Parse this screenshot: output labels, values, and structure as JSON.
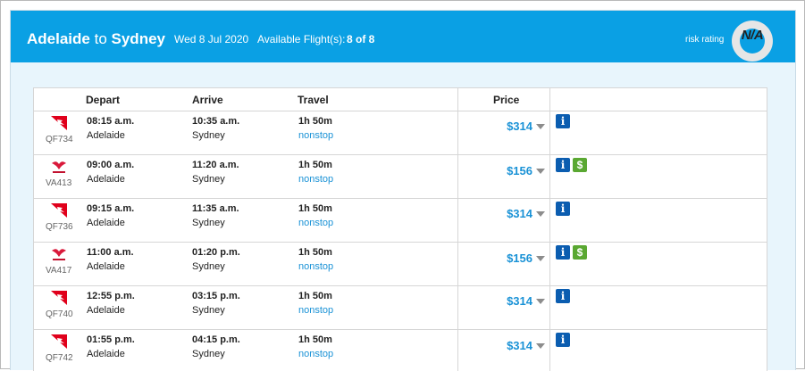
{
  "header": {
    "origin": "Adelaide",
    "to_word": "to",
    "destination": "Sydney",
    "date": "Wed 8 Jul 2020",
    "available_label": "Available Flight(s):",
    "available_count": "8 of 8",
    "risk_label": "risk rating",
    "risk_value": "N/A"
  },
  "columns": {
    "depart": "Depart",
    "arrive": "Arrive",
    "travel": "Travel",
    "price": "Price"
  },
  "colors": {
    "header_bg": "#0aa0e4",
    "price_text": "#1a92d6",
    "info_badge": "#0b5db0",
    "deal_badge": "#5aa832"
  },
  "flights": [
    {
      "airline_icon": "qantas-logo",
      "code": "QF734",
      "depart_time": "08:15 a.m.",
      "depart_city": "Adelaide",
      "arrive_time": "10:35 a.m.",
      "arrive_city": "Sydney",
      "duration": "1h 50m",
      "stops": "nonstop",
      "price": "$314",
      "info_badge": "i",
      "deal_badge": ""
    },
    {
      "airline_icon": "virgin-australia-logo",
      "code": "VA413",
      "depart_time": "09:00 a.m.",
      "depart_city": "Adelaide",
      "arrive_time": "11:20 a.m.",
      "arrive_city": "Sydney",
      "duration": "1h 50m",
      "stops": "nonstop",
      "price": "$156",
      "info_badge": "i",
      "deal_badge": "$"
    },
    {
      "airline_icon": "qantas-logo",
      "code": "QF736",
      "depart_time": "09:15 a.m.",
      "depart_city": "Adelaide",
      "arrive_time": "11:35 a.m.",
      "arrive_city": "Sydney",
      "duration": "1h 50m",
      "stops": "nonstop",
      "price": "$314",
      "info_badge": "i",
      "deal_badge": ""
    },
    {
      "airline_icon": "virgin-australia-logo",
      "code": "VA417",
      "depart_time": "11:00 a.m.",
      "depart_city": "Adelaide",
      "arrive_time": "01:20 p.m.",
      "arrive_city": "Sydney",
      "duration": "1h 50m",
      "stops": "nonstop",
      "price": "$156",
      "info_badge": "i",
      "deal_badge": "$"
    },
    {
      "airline_icon": "qantas-logo",
      "code": "QF740",
      "depart_time": "12:55 p.m.",
      "depart_city": "Adelaide",
      "arrive_time": "03:15 p.m.",
      "arrive_city": "Sydney",
      "duration": "1h 50m",
      "stops": "nonstop",
      "price": "$314",
      "info_badge": "i",
      "deal_badge": ""
    },
    {
      "airline_icon": "qantas-logo",
      "code": "QF742",
      "depart_time": "01:55 p.m.",
      "depart_city": "Adelaide",
      "arrive_time": "04:15 p.m.",
      "arrive_city": "Sydney",
      "duration": "1h 50m",
      "stops": "nonstop",
      "price": "$314",
      "info_badge": "i",
      "deal_badge": ""
    }
  ]
}
